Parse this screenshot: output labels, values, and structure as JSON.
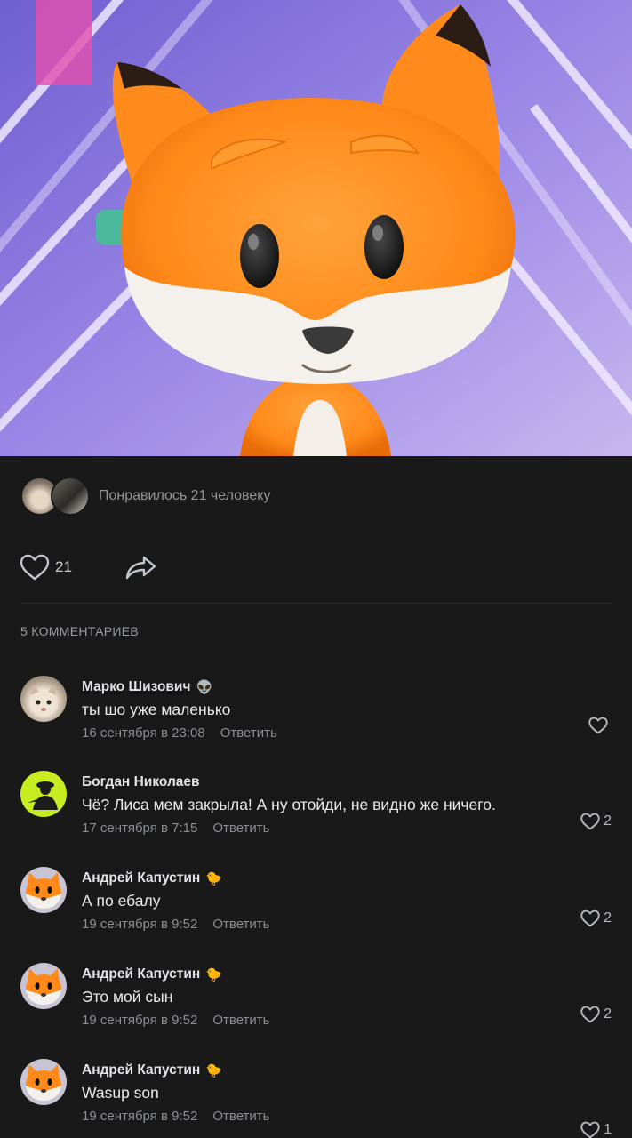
{
  "post": {
    "likes_summary": "Понравилось 21 человеку",
    "like_count": "21",
    "comments_header": "5 КОММЕНТАРИЕВ"
  },
  "icons": {
    "like": "heart-icon",
    "share": "share-arrow-icon"
  },
  "colors": {
    "background": "#19191a",
    "secondary_text": "#939699",
    "primary_text": "#e1e3e6"
  },
  "comments": [
    {
      "author": "Марко Шизович",
      "badge": "👽",
      "text": "ты шо уже маленько",
      "date": "16 сентября в 23:08",
      "reply": "Ответить",
      "likes": ""
    },
    {
      "author": "Богдан Николаев",
      "badge": "",
      "text": "Чё? Лиса мем закрыла! А ну отойди, не видно же ничего.",
      "date": "17 сентября в 7:15",
      "reply": "Ответить",
      "likes": "2"
    },
    {
      "author": "Андрей Капустин",
      "badge": "🐤",
      "text": "А по ебалу",
      "date": "19 сентября в 9:52",
      "reply": "Ответить",
      "likes": "2"
    },
    {
      "author": "Андрей Капустин",
      "badge": "🐤",
      "text": "Это мой сын",
      "date": "19 сентября в 9:52",
      "reply": "Ответить",
      "likes": "2"
    },
    {
      "author": "Андрей Капустин",
      "badge": "🐤",
      "text": "Wasup son",
      "date": "19 сентября в 9:52",
      "reply": "Ответить",
      "likes": "1"
    }
  ]
}
